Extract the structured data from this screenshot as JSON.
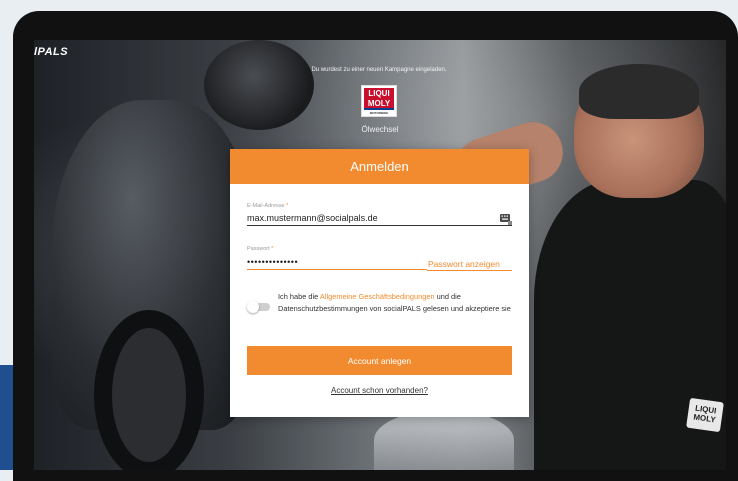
{
  "brand": {
    "logo_text": "lPALS"
  },
  "campaign": {
    "invite_text": "Du wurdest zu einer neuen Kampagne eingeladen.",
    "sponsor_logo": {
      "line1": "LIQUI",
      "line2": "MOLY",
      "subline": "MOTORBIKE"
    },
    "name": "Ölwechsel"
  },
  "background": {
    "patch_text": "LIQUI MOLY"
  },
  "form": {
    "title": "Anmelden",
    "email": {
      "label": "E-Mail-Adresse",
      "required_mark": "*",
      "value": "max.mustermann@socialpals.de",
      "icon": "keyboard-icon"
    },
    "password": {
      "label": "Passwort",
      "required_mark": "*",
      "value": "••••••••••••••",
      "show_label": "Passwort anzeigen"
    },
    "consent": {
      "prefix": "Ich habe die ",
      "link_text": "Allgemeine Geschäftsbedingungen",
      "suffix": " und die Datenschutzbestimmungen von socialPALS gelesen und akzeptiere sie",
      "checked": false
    },
    "submit_label": "Account anlegen",
    "login_link": "Account schon vorhanden?"
  },
  "colors": {
    "accent": "#f28b30",
    "device": "#111111",
    "edge_blue": "#1f4f8f"
  }
}
